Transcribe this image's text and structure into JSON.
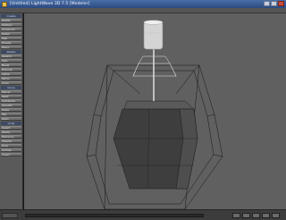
{
  "window": {
    "title": "[Untitled] LightWave 3D 7.5 [Modeler]"
  },
  "sidebar": {
    "items": [
      {
        "label": "Create"
      },
      {
        "label": "Modify"
      },
      {
        "label": "Multiply"
      },
      {
        "label": "Construct"
      },
      {
        "label": "Detail"
      },
      {
        "label": "Map"
      },
      {
        "label": "Display"
      },
      {
        "label": "Move"
      },
      {
        "label": "Rotate"
      },
      {
        "label": "Stretch"
      },
      {
        "label": "Size"
      },
      {
        "label": "Bevel"
      },
      {
        "label": "Extrude"
      },
      {
        "label": "Lathe"
      },
      {
        "label": "Mirror"
      },
      {
        "label": "Array"
      },
      {
        "label": "Clone"
      },
      {
        "label": "Merge"
      },
      {
        "label": "Weld"
      },
      {
        "label": "Subdivide"
      },
      {
        "label": "Smooth"
      },
      {
        "label": "Triple"
      },
      {
        "label": "Flip"
      },
      {
        "label": "Align"
      },
      {
        "label": "Unify"
      },
      {
        "label": "Select"
      },
      {
        "label": "Points"
      },
      {
        "label": "Polygons"
      },
      {
        "label": "Volume"
      },
      {
        "label": "Hide"
      },
      {
        "label": "Unhide"
      },
      {
        "label": "Invert"
      }
    ]
  },
  "colors": {
    "viewport_bg": "#606060",
    "wireframe": "#111111",
    "cage": "#e8e8e8",
    "mesh_dark": "#3a3a3a",
    "mesh_mid": "#4a4a4a"
  }
}
